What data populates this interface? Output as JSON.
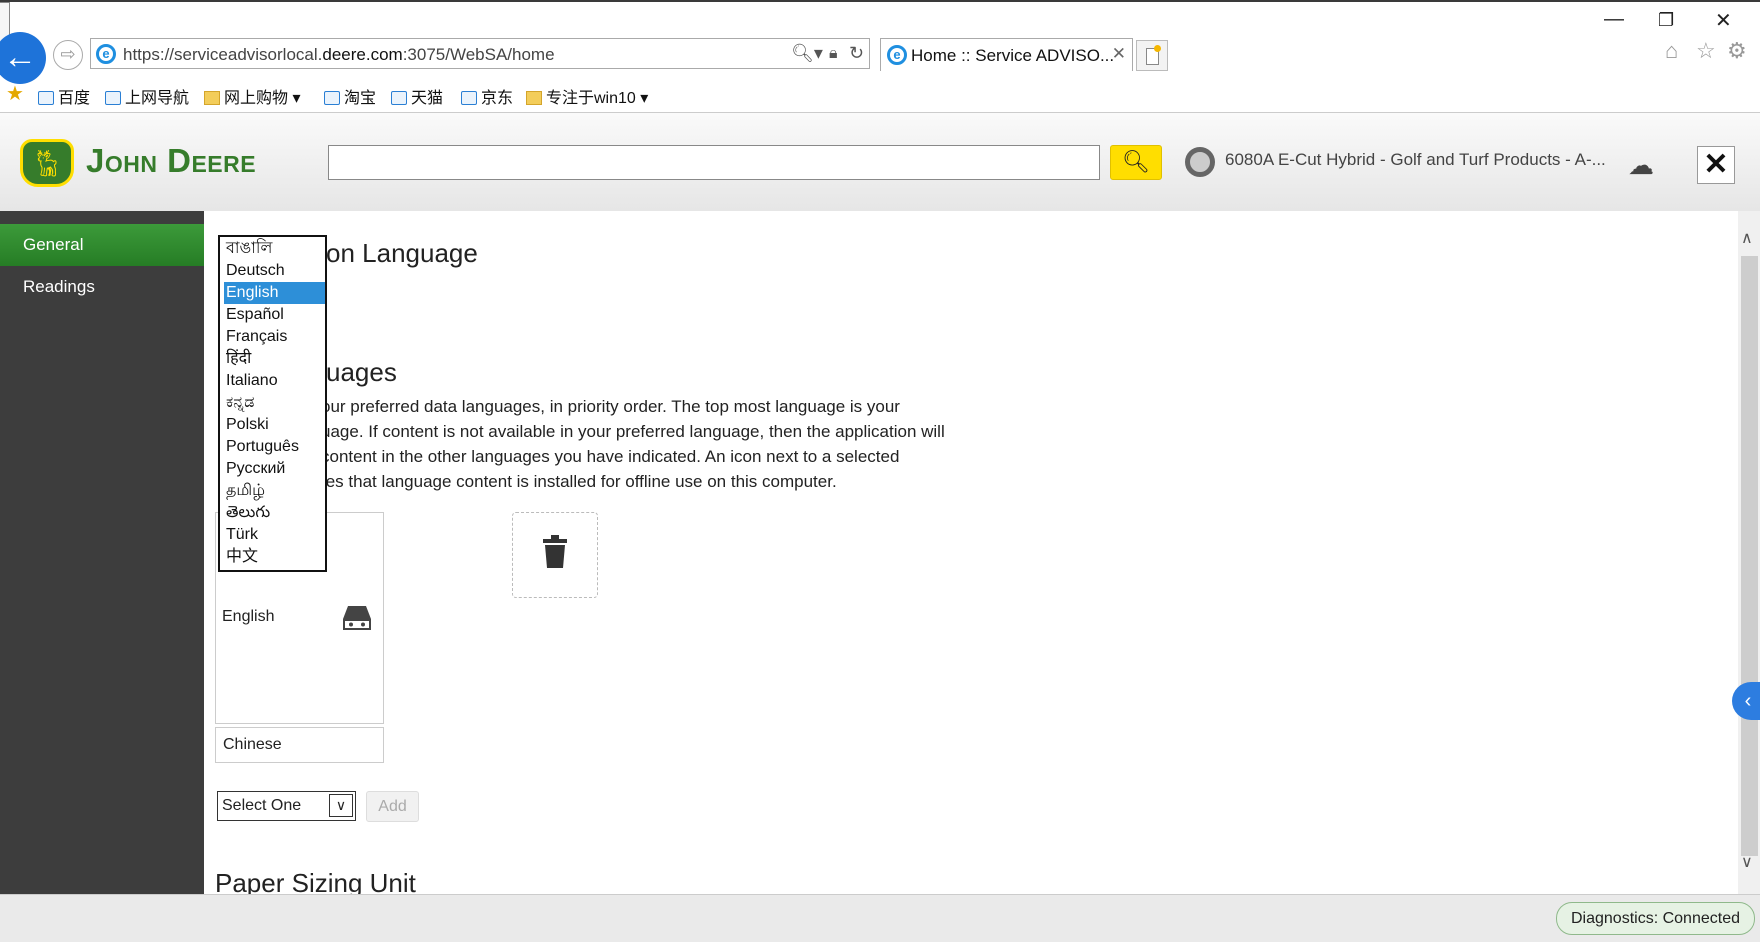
{
  "browser": {
    "url_prefix": "https://serviceadvisorlocal.",
    "url_domain": "deere.com",
    "url_suffix": ":3075/WebSA/home",
    "tab_title": "Home :: Service ADVISO...",
    "favorites": [
      {
        "label": "百度",
        "icon": "page-icon"
      },
      {
        "label": "上网导航",
        "icon": "page-icon"
      },
      {
        "label": "网上购物",
        "icon": "folder-icon",
        "dropdown": true
      },
      {
        "label": "淘宝",
        "icon": "page-icon"
      },
      {
        "label": "天猫",
        "icon": "page-icon"
      },
      {
        "label": "京东",
        "icon": "page-icon"
      },
      {
        "label": "专注于win10",
        "icon": "folder-icon",
        "dropdown": true
      }
    ]
  },
  "header": {
    "brand": "John Deere",
    "search_value": "",
    "machine": "6080A E-Cut Hybrid - Golf and Turf Products - A-..."
  },
  "sidebar": {
    "items": [
      {
        "label": "General",
        "active": true
      },
      {
        "label": "Readings",
        "active": false
      }
    ]
  },
  "main": {
    "app_language_heading_tail": "on Language",
    "data_languages_heading_tail": "uages",
    "description_lines": [
      "our preferred data languages, in priority order. The top most language is your",
      "uage. If content is not available in your preferred language, then the application will",
      "content in the other languages you have indicated. An icon next to a selected",
      "tes that language content is installed for offline use on this computer."
    ],
    "preferred_language": "English",
    "secondary_language": "Chinese",
    "select_value": "Select One",
    "add_label": "Add",
    "paper_heading": "Paper Sizing Unit"
  },
  "dropdown": {
    "options": [
      "বাঙালি",
      "Deutsch",
      "English",
      "Español",
      "Français",
      "हिंदी",
      "Italiano",
      "ಕನ್ನಡ",
      "Polski",
      "Português",
      "Русский",
      "தமிழ்",
      "తెలుగు",
      "Türk",
      "中文"
    ],
    "selected": "English"
  },
  "status": {
    "diagnostics": "Diagnostics: Connected"
  },
  "colors": {
    "brand_green": "#367c2b",
    "brand_yellow": "#ffde00",
    "selection_blue": "#2d8fd8"
  }
}
